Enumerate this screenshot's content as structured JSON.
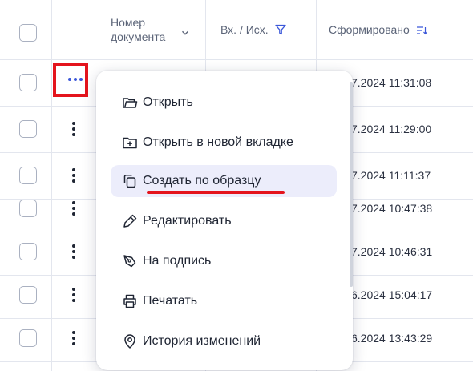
{
  "header": {
    "doc_number_line1": "Номер",
    "doc_number_line2": "документа",
    "direction": "Вх. / Исх.",
    "generated": "Сформировано"
  },
  "rows": [
    {
      "date": "7.2024 11:31:08"
    },
    {
      "date": "7.2024 11:29:00"
    },
    {
      "date": "7.2024 11:11:37"
    },
    {
      "date": "7.2024 10:47:38"
    },
    {
      "date": "7.2024 10:46:31"
    },
    {
      "date": "6.2024 15:04:17"
    },
    {
      "date": "6.2024 13:43:29"
    }
  ],
  "menu": {
    "items": [
      {
        "label": "Открыть",
        "icon": "folder-open-icon"
      },
      {
        "label": "Открыть в новой вкладке",
        "icon": "new-tab-icon"
      },
      {
        "label": "Создать по образцу",
        "icon": "copy-icon"
      },
      {
        "label": "Редактировать",
        "icon": "edit-icon"
      },
      {
        "label": "На подпись",
        "icon": "sign-icon"
      },
      {
        "label": "Печатать",
        "icon": "print-icon"
      },
      {
        "label": "История изменений",
        "icon": "history-icon"
      }
    ]
  },
  "colors": {
    "accent": "#3b57d9",
    "highlight": "#e4141d",
    "active_bg": "#ecedfb"
  }
}
